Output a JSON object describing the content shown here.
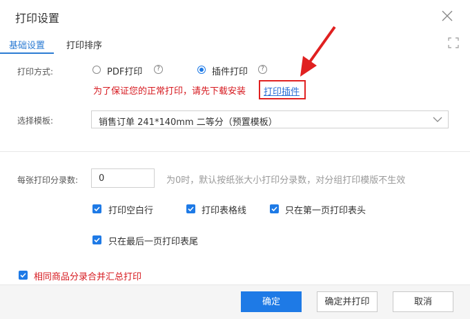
{
  "dialog": {
    "title": "打印设置"
  },
  "tabs": [
    {
      "label": "基础设置",
      "active": true
    },
    {
      "label": "打印排序",
      "active": false
    }
  ],
  "print_method": {
    "label": "打印方式:",
    "options": [
      {
        "label": "PDF打印",
        "selected": false
      },
      {
        "label": "插件打印",
        "selected": true
      }
    ],
    "help_glyph": "?",
    "warning": "为了保证您的正常打印，请先下载安装",
    "plugin_link": "打印插件"
  },
  "template": {
    "label": "选择模板:",
    "selected": "销售订单 241*140mm 二等分（预置模板）"
  },
  "copies": {
    "label": "每张打印分录数:",
    "value": "0",
    "hint": "为0时，默认按纸张大小打印分录数，对分组打印模版不生效"
  },
  "options": [
    {
      "label": "打印空白行",
      "checked": true
    },
    {
      "label": "打印表格线",
      "checked": true
    },
    {
      "label": "只在第一页打印表头",
      "checked": true
    },
    {
      "label": "只在最后一页打印表尾",
      "checked": true
    }
  ],
  "merge_option": {
    "label": "相同商品分录合并汇总打印",
    "checked": true
  },
  "footer": {
    "confirm": "确定",
    "confirm_print": "确定并打印",
    "cancel": "取消"
  },
  "colors": {
    "accent": "#1e7ae6",
    "warning": "#d6181e",
    "annotation": "#e02020"
  }
}
